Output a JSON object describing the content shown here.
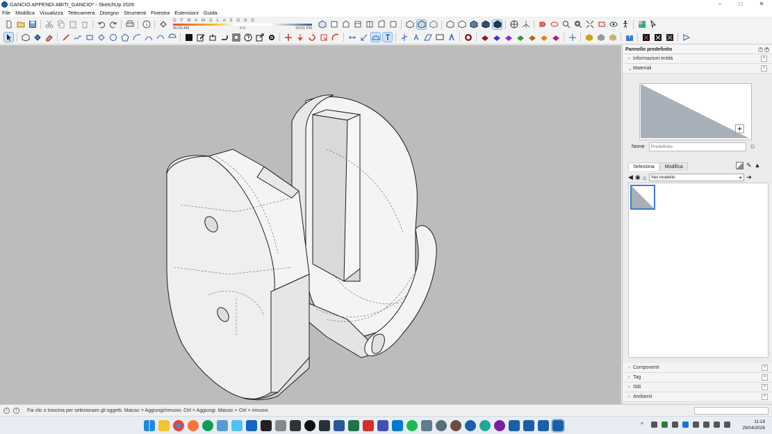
{
  "window": {
    "title": "GANCIO APPENDI ABITI_GANCIO* - SketchUp 2026",
    "controls": [
      "–",
      "□",
      "✕"
    ]
  },
  "menu": [
    "File",
    "Modifica",
    "Visualizza",
    "Telecamera",
    "Disegno",
    "Strumenti",
    "Finestra",
    "Estensioni",
    "Guida"
  ],
  "shadow_widget": {
    "months": "G F M A M G L A S O N D",
    "time_start": "06:55 AM",
    "time_mid": "0:0",
    "time_end": "04:51 PM"
  },
  "panel": {
    "title": "Pannello predefinito",
    "sections_top": [
      "Informazioni entità",
      "Materiali"
    ],
    "name_label": "Nome",
    "name_placeholder": "Predefinito",
    "tabs": [
      "Seleziona",
      "Modifica"
    ],
    "library": "Nel modello",
    "sections_bottom": [
      "Componenti",
      "Tag",
      "Stili",
      "Ambienti"
    ]
  },
  "status": {
    "message": "Fai clic o trascina per selezionare gli oggetti. Maiusc = Aggiungi/rimuovi. Ctrl = Aggiungi. Maiusc + Ctrl = rimuovi."
  },
  "taskbar": {
    "time": "11:18",
    "date": "29/04/2026"
  },
  "colors": {
    "viewport_bg": "#bcbcbc",
    "model_face": "#f2f2f2",
    "material_swatch": "#a7b0b8",
    "selection_blue": "#3a7bd5"
  }
}
